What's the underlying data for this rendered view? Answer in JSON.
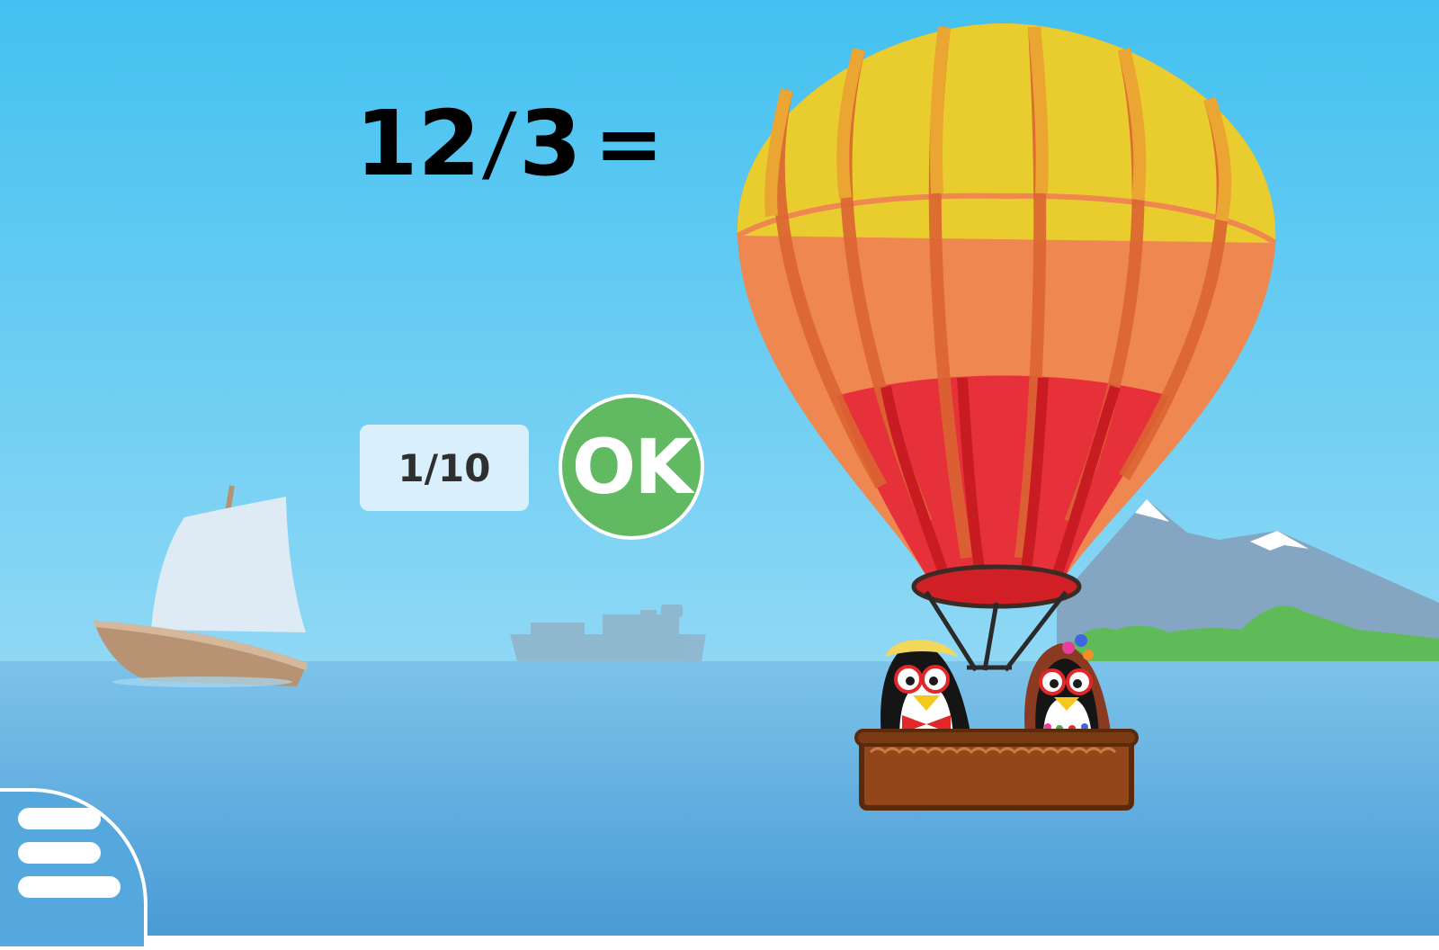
{
  "equation": {
    "left_operand": "12",
    "operator": "/",
    "right_operand": "3",
    "equals": "="
  },
  "progress": {
    "counter_text": "1/10"
  },
  "ok_button": {
    "label": "OK"
  },
  "colors": {
    "sky_top": "#43c1f0",
    "sky_bottom": "#8fd8f5",
    "sea_top": "#7cc3ea",
    "sea_bottom": "#4a9ad5",
    "ok_green": "#61b962",
    "counter_bg": "#d9f0fc"
  },
  "icons": {
    "menu": "hamburger-menu-icon"
  }
}
